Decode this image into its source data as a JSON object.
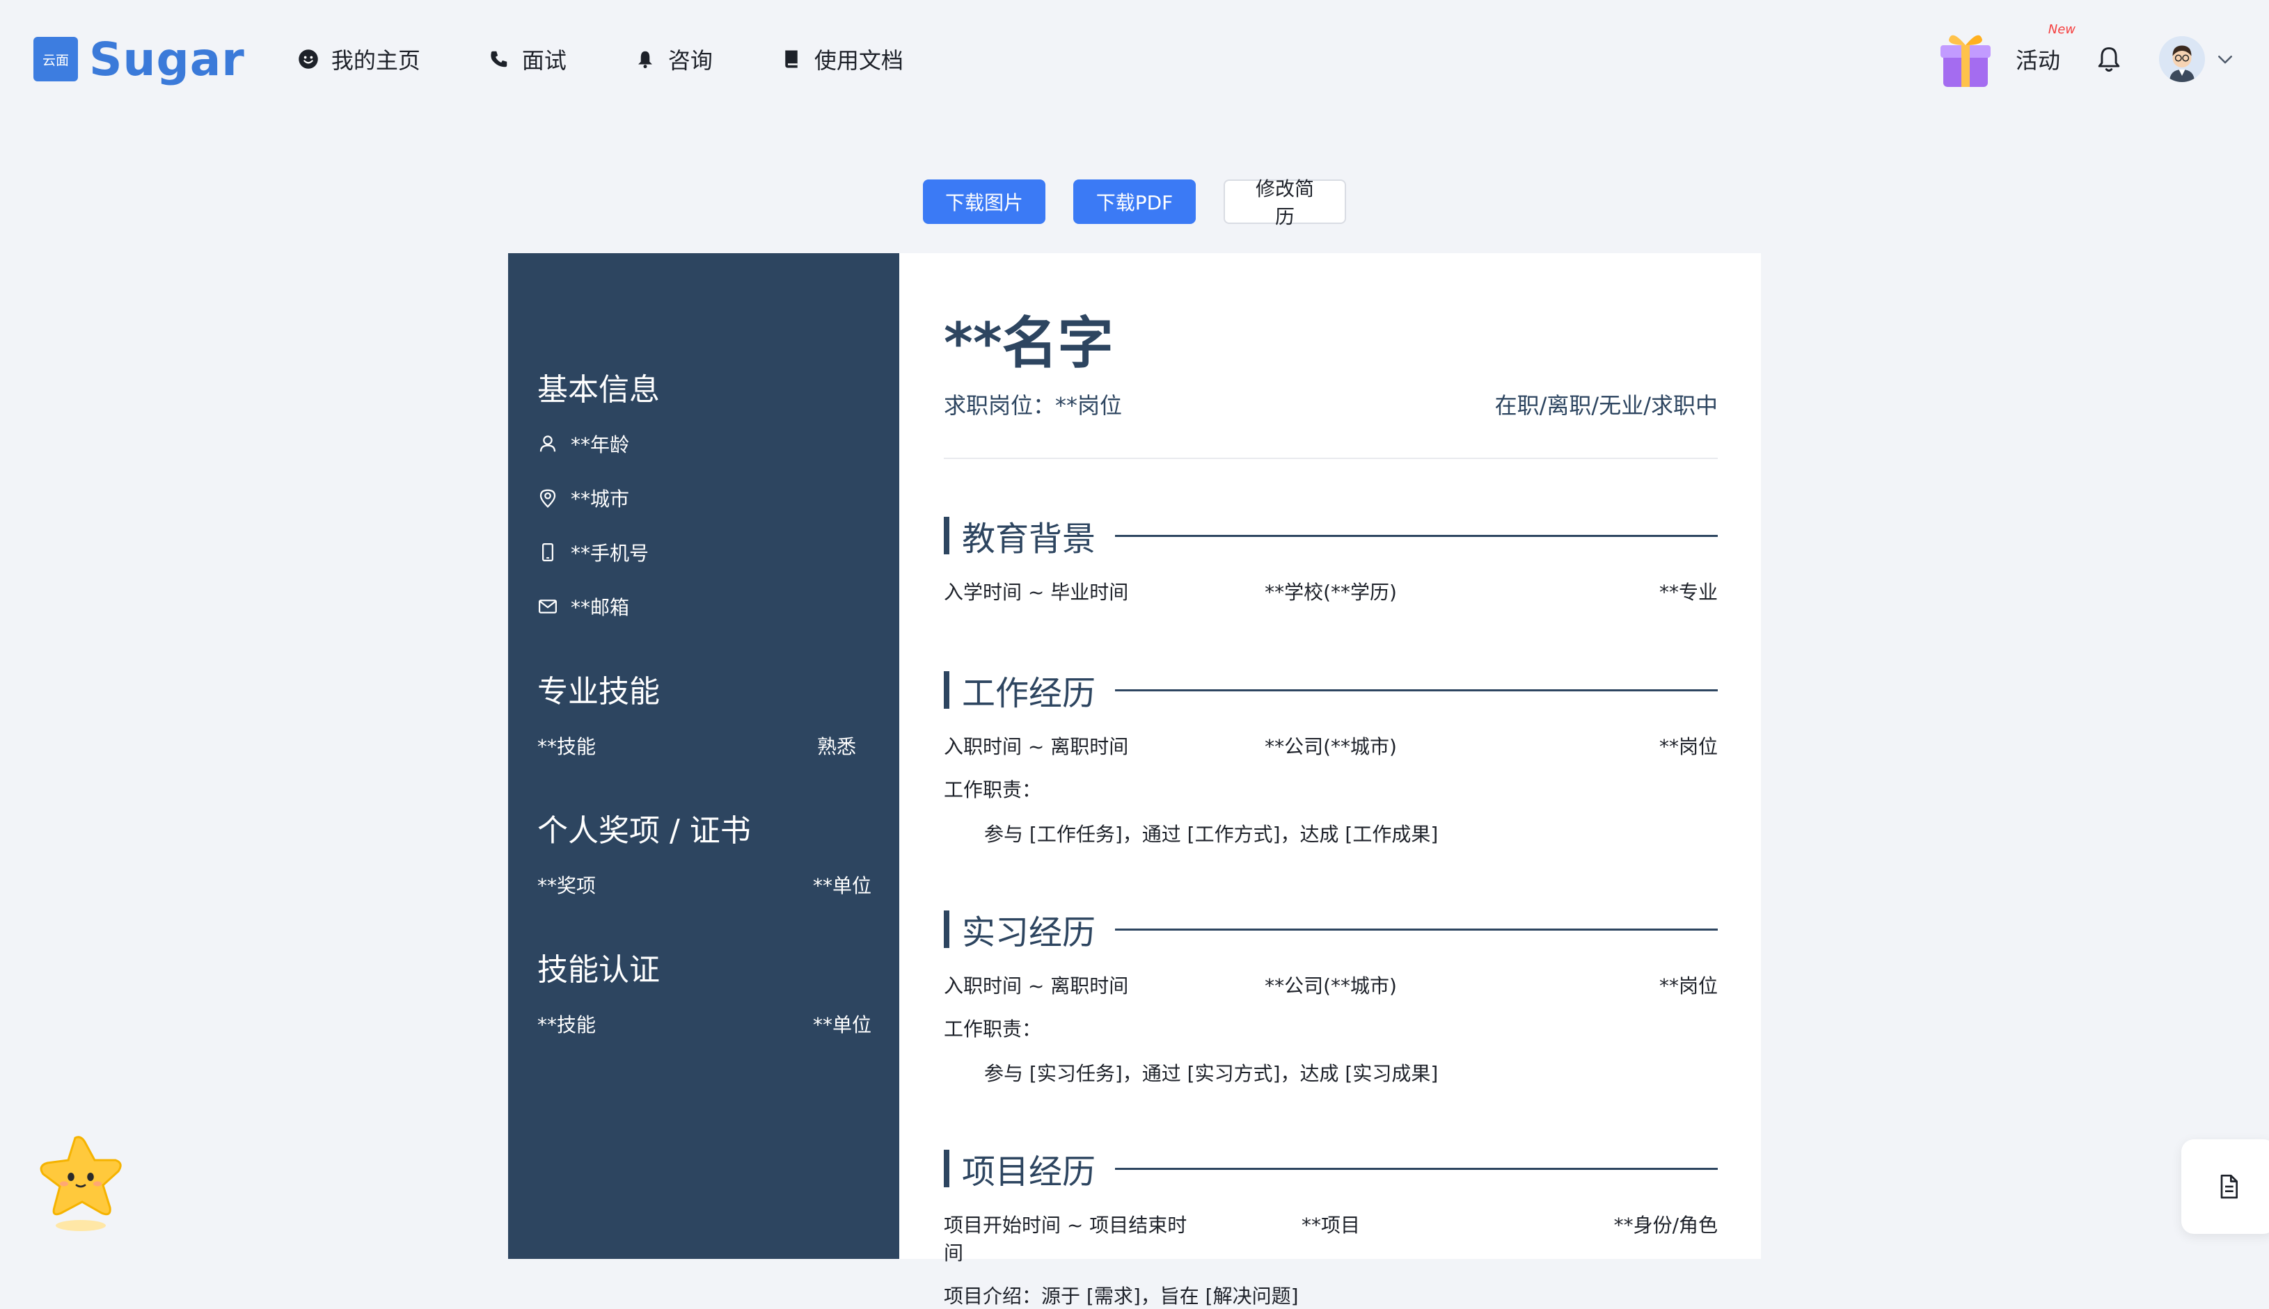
{
  "header": {
    "logo_mark": "云面",
    "logo_text": "Sugar",
    "nav": [
      {
        "label": "我的主页",
        "icon": "smiley-icon"
      },
      {
        "label": "面试",
        "icon": "phone-icon"
      },
      {
        "label": "咨询",
        "icon": "bell-icon"
      },
      {
        "label": "使用文档",
        "icon": "book-icon"
      }
    ],
    "activity_label": "活动",
    "activity_badge": "New"
  },
  "toolbar": {
    "download_image": "下载图片",
    "download_pdf": "下载PDF",
    "edit_resume": "修改简历"
  },
  "resume": {
    "sidebar": {
      "basic_title": "基本信息",
      "age": "**年龄",
      "city": "**城市",
      "phone": "**手机号",
      "email": "**邮箱",
      "skills_title": "专业技能",
      "skill_name": "**技能",
      "skill_level": "熟悉",
      "awards_title": "个人奖项 / 证书",
      "award_name": "**奖项",
      "award_unit": "**单位",
      "cert_title": "技能认证",
      "cert_name": "**技能",
      "cert_unit": "**单位"
    },
    "name": "**名字",
    "position": "求职岗位：**岗位",
    "status": "在职/离职/无业/求职中",
    "education": {
      "title": "教育背景",
      "time": "入学时间 ~ 毕业时间",
      "school": "**学校(**学历)",
      "major": "**专业"
    },
    "work": {
      "title": "工作经历",
      "time": "入职时间 ~ 离职时间",
      "company": "**公司(**城市)",
      "role": "**岗位",
      "duty_label": "工作职责：",
      "duty": "参与 [工作任务]，通过 [工作方式]，达成 [工作成果]"
    },
    "intern": {
      "title": "实习经历",
      "time": "入职时间 ~ 离职时间",
      "company": "**公司(**城市)",
      "role": "**岗位",
      "duty_label": "工作职责：",
      "duty": "参与 [实习任务]，通过 [实习方式]，达成 [实习成果]"
    },
    "project": {
      "title": "项目经历",
      "time": "项目开始时间 ~ 项目结束时间",
      "name": "**项目",
      "role": "**身份/角色",
      "intro": "项目介绍：源于 [需求]，旨在 [解决问题]"
    }
  },
  "colors": {
    "primary": "#3b7af5",
    "sidebar": "#2d4560",
    "badge": "#f53f3f"
  }
}
